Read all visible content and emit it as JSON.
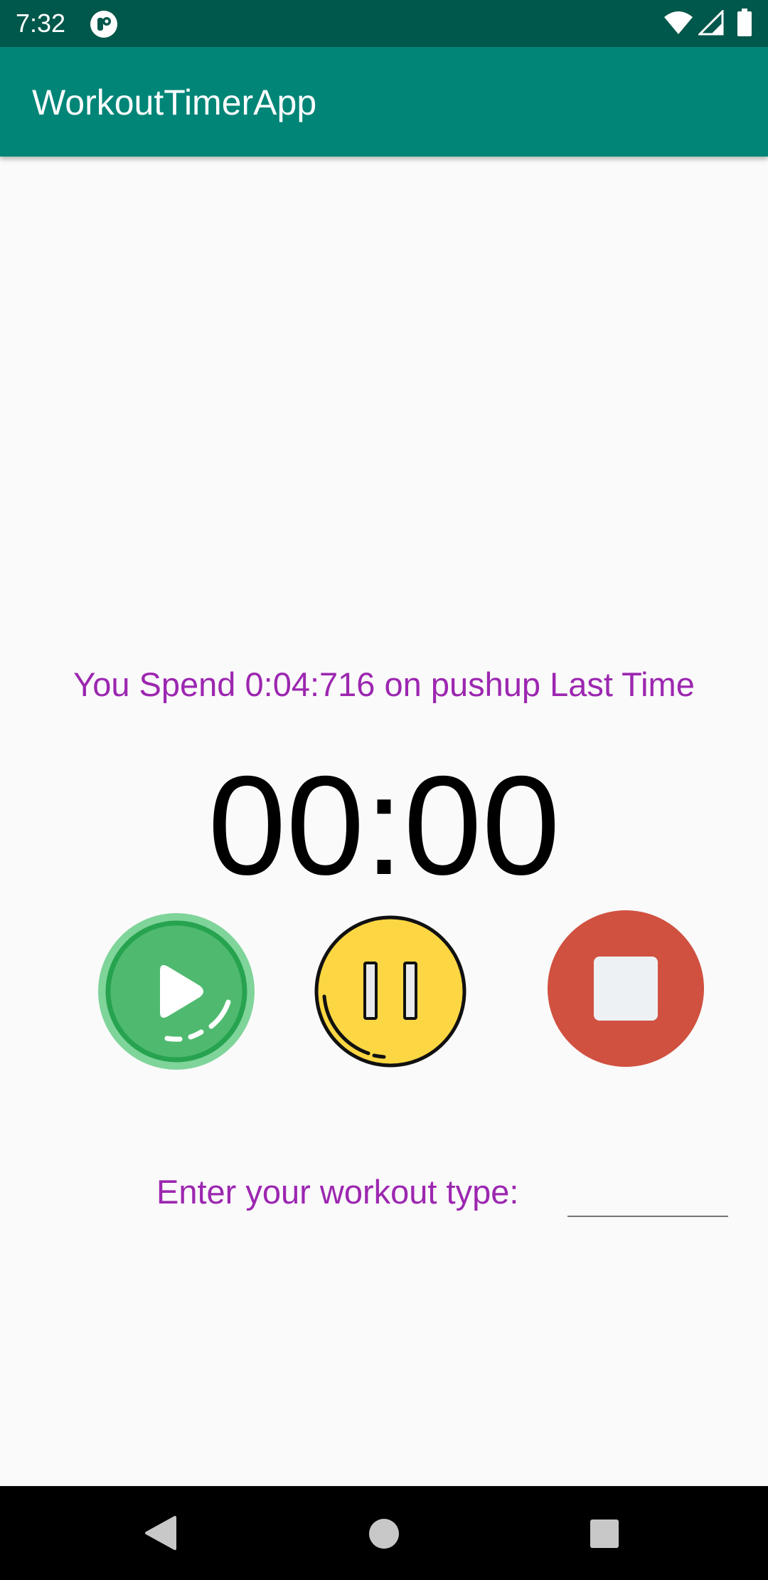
{
  "status_bar": {
    "time": "7:32",
    "icons": [
      "app-notification-icon",
      "wifi-icon",
      "cell-signal-icon",
      "battery-icon"
    ]
  },
  "app_bar": {
    "title": "WorkoutTimerApp",
    "color": "#008577"
  },
  "main": {
    "last_time_text": "You Spend 0:04:716 on pushup Last Time",
    "timer": "00:00",
    "controls": {
      "play_icon": "play-icon",
      "pause_icon": "pause-icon",
      "stop_icon": "stop-icon"
    },
    "workout_label": "Enter your workout type:",
    "workout_input_value": "",
    "accent_text_color": "#9c27b0"
  },
  "nav_bar": {
    "icons": [
      "back-icon",
      "home-icon",
      "recents-icon"
    ]
  }
}
